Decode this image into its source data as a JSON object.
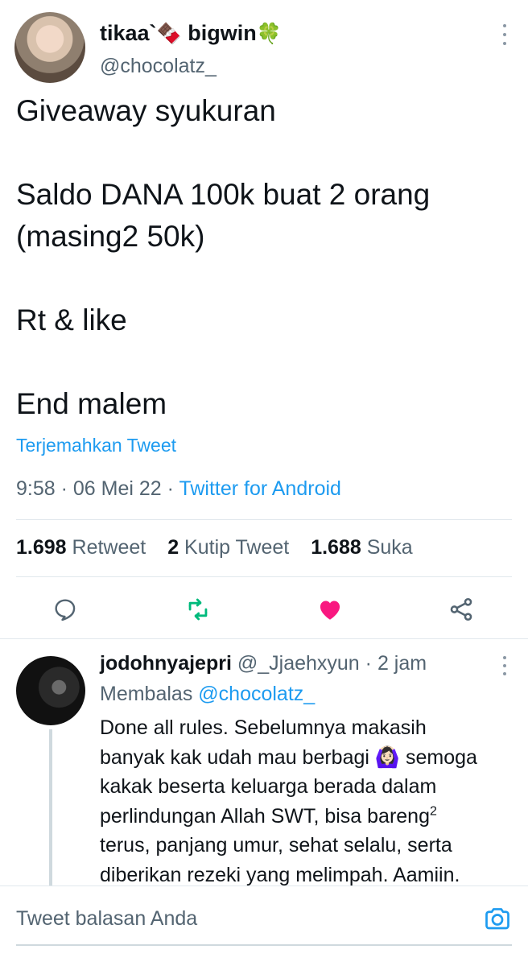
{
  "tweet": {
    "display_name": "tikaa`",
    "display_name_suffix": "bigwin",
    "emoji_1": "🍫",
    "emoji_2": "🍀",
    "handle": "@chocolatz_",
    "lines": [
      "Giveaway syukuran",
      "Saldo DANA 100k buat 2 orang",
      "(masing2 50k)",
      "Rt & like",
      "End malem"
    ],
    "translate_label": "Terjemahkan Tweet",
    "time": "9:58",
    "date": "06 Mei 22",
    "source": "Twitter for Android",
    "stats": {
      "retweets": "1.698",
      "retweets_label": "Retweet",
      "quotes": "2",
      "quotes_label": "Kutip Tweet",
      "likes": "1.688",
      "likes_label": "Suka"
    },
    "colors": {
      "accent": "#1d9bf0",
      "retweet": "#00ba7c",
      "like": "#f91880",
      "muted": "#536471"
    }
  },
  "reply": {
    "display_name": "jodohnyajepri",
    "handle": "@_Jjaehxyun",
    "time": "2 jam",
    "replying_label": "Membalas",
    "replying_to": "@chocolatz_",
    "lines": [
      "Done all rules. Sebelumnya makasih",
      "banyak kak udah mau berbagi",
      "semoga",
      "kakak beserta keluarga berada dalam",
      "perlindungan Allah SWT, bisa bareng",
      "2",
      "terus, panjang umur, sehat selalu, serta",
      "diberikan rezeki yang melimpah. Aamiin."
    ],
    "emoji": "🙆🏻‍♀️"
  },
  "composer": {
    "placeholder": "Tweet balasan Anda"
  }
}
